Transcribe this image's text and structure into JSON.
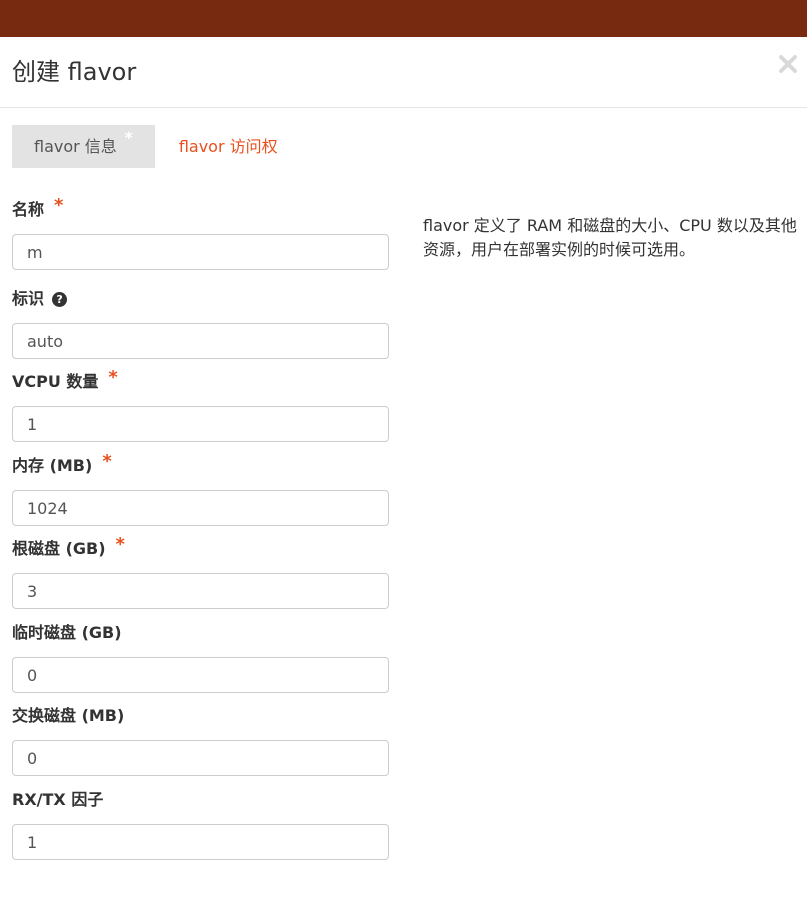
{
  "header": {
    "title": "创建 flavor",
    "close_icon": "close-icon"
  },
  "tabs": [
    {
      "label": "flavor 信息",
      "star": "*"
    },
    {
      "label": "flavor 访问权"
    }
  ],
  "colors": {
    "topbar": "#772a10",
    "accent": "#e8511d",
    "active_tab_bg": "#e3e3e3"
  },
  "fields": {
    "name": {
      "label": "名称",
      "required": "*",
      "value": "m"
    },
    "id": {
      "label": "标识",
      "help_icon": "question-circle-icon",
      "help_glyph": "?",
      "value": "auto"
    },
    "vcpus": {
      "label": "VCPU 数量",
      "required": "*",
      "value": "1"
    },
    "ram": {
      "label": "内存 (MB)",
      "required": "*",
      "value": "1024"
    },
    "root_disk": {
      "label": "根磁盘 (GB)",
      "required": "*",
      "value": "3"
    },
    "ephemeral_disk": {
      "label": "临时磁盘 (GB)",
      "value": "0"
    },
    "swap_disk": {
      "label": "交换磁盘 (MB)",
      "value": "0"
    },
    "rxtx_factor": {
      "label": "RX/TX 因子",
      "value": "1"
    }
  },
  "description": "flavor 定义了 RAM 和磁盘的大小、CPU 数以及其他资源，用户在部署实例的时候可选用。"
}
